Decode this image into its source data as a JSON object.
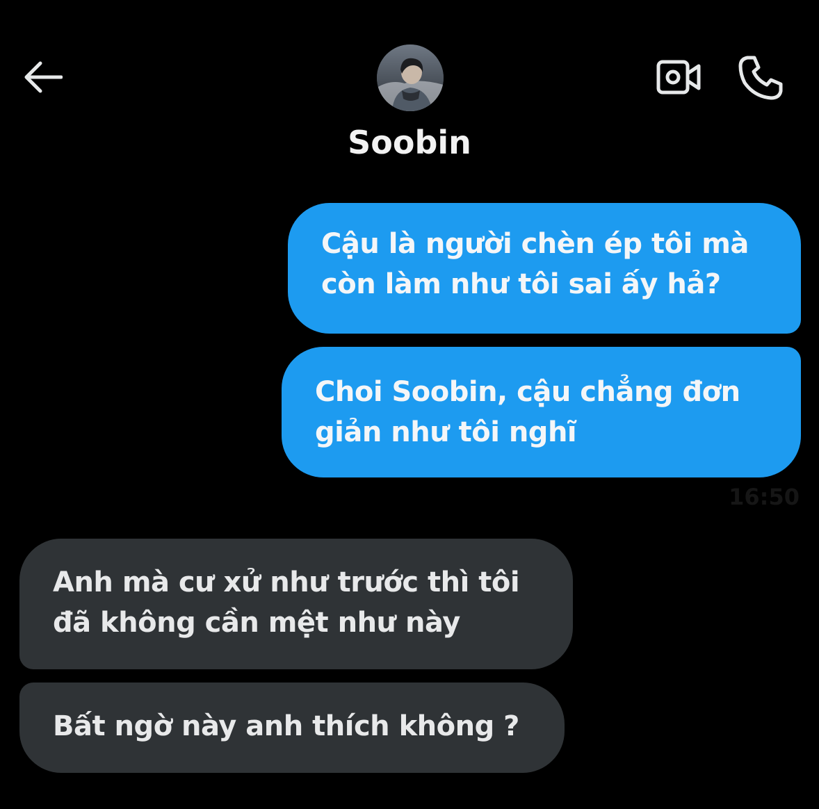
{
  "header": {
    "contact_name": "Soobin",
    "icons": {
      "back": "arrow-left-icon",
      "video_call": "video-camera-icon",
      "voice_call": "phone-icon",
      "avatar": "profile-photo"
    }
  },
  "messages": [
    {
      "direction": "outgoing",
      "lines": [
        "Cậu là người chèn ép tôi mà",
        "còn làm như tôi sai ấy hả?"
      ]
    },
    {
      "direction": "outgoing",
      "lines": [
        "Choi Soobin, cậu chẳng đơn",
        "giản như tôi nghĩ"
      ]
    },
    {
      "direction": "incoming",
      "lines": [
        "Anh mà cư xử như trước thì tôi",
        "đã không cần mệt như này"
      ]
    },
    {
      "direction": "incoming",
      "lines": [
        "Bất ngờ này anh thích không ?"
      ]
    }
  ],
  "outgoing_timestamp": "16:50",
  "colors": {
    "background": "#000000",
    "outgoing_bubble": "#1d9bf0",
    "incoming_bubble": "#2f3336",
    "text": "#f4f6f8"
  }
}
